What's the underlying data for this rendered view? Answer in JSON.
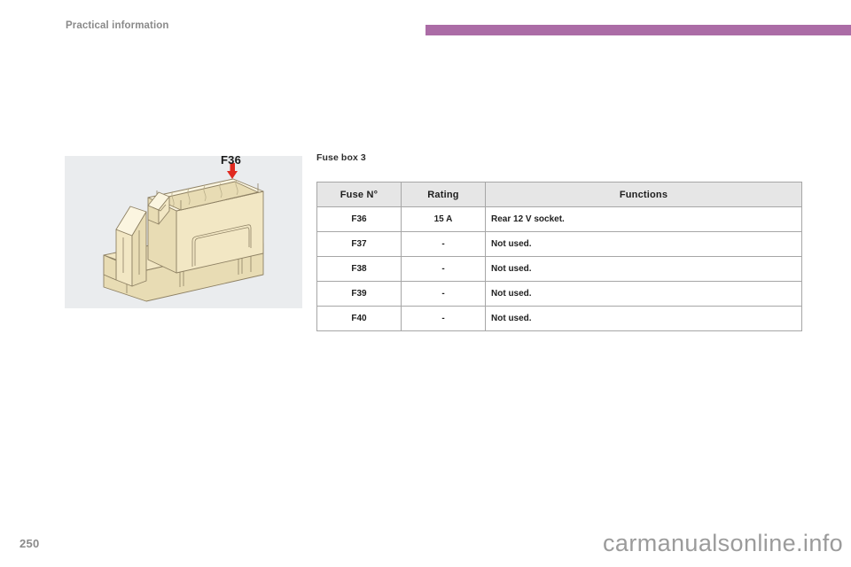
{
  "header": {
    "running_title": "Practical information",
    "bar_color": "#ab6ca6"
  },
  "figure": {
    "callout_label": "F36",
    "alt_name": "fuse-box-illustration",
    "panel_background": "#eaecee",
    "body_color": "#f2e7c4",
    "arrow_color": "#e02a20"
  },
  "section": {
    "title": "Fuse box 3"
  },
  "table": {
    "columns": [
      "Fuse N°",
      "Rating",
      "Functions"
    ],
    "rows": [
      {
        "fuse": "F36",
        "rating": "15 A",
        "functions": "Rear 12 V socket."
      },
      {
        "fuse": "F37",
        "rating": "-",
        "functions": "Not used."
      },
      {
        "fuse": "F38",
        "rating": "-",
        "functions": "Not used."
      },
      {
        "fuse": "F39",
        "rating": "-",
        "functions": "Not used."
      },
      {
        "fuse": "F40",
        "rating": "-",
        "functions": "Not used."
      }
    ]
  },
  "footer": {
    "page_number": "250",
    "watermark": "carmanualsonline.info"
  }
}
